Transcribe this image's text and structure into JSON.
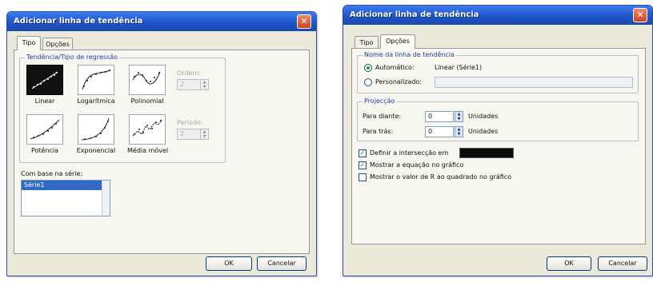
{
  "dialog_type": {
    "title": "Adicionar linha de tendência",
    "close_glyph": "✕",
    "tabs": [
      {
        "label": "Tipo",
        "active": true
      },
      {
        "label": "Opções",
        "active": false
      }
    ],
    "group_label": "Tendência/Tipo de regressão",
    "types": [
      {
        "label": "Linear",
        "icon": "linear-chart-icon",
        "selected": true
      },
      {
        "label": "Logarítmica",
        "icon": "log-chart-icon",
        "selected": false
      },
      {
        "label": "Polinomial",
        "icon": "polynomial-chart-icon",
        "selected": false
      },
      {
        "label": "Potência",
        "icon": "power-chart-icon",
        "selected": false
      },
      {
        "label": "Exponencial",
        "icon": "exponential-chart-icon",
        "selected": false
      },
      {
        "label": "Média móvel",
        "icon": "moving-average-chart-icon",
        "selected": false
      }
    ],
    "order_label": "Ordem:",
    "order_value": "2",
    "period_label": "Período:",
    "period_value": "2",
    "series_label": "Com base na série:",
    "series_items": [
      "Série1"
    ],
    "ok_label": "OK",
    "cancel_label": "Cancelar"
  },
  "dialog_options": {
    "title": "Adicionar linha de tendência",
    "close_glyph": "✕",
    "tabs": [
      {
        "label": "Tipo",
        "active": false
      },
      {
        "label": "Opções",
        "active": true
      }
    ],
    "name_group_label": "Nome da linha de tendência",
    "automatic_label": "Automático:",
    "automatic_value": "Linear (Série1)",
    "custom_label": "Personalizado:",
    "custom_value": "",
    "projection_group_label": "Projecção",
    "forward_label": "Para diante:",
    "forward_value": "0",
    "backward_label": "Para trás:",
    "backward_value": "0",
    "units_label": "Unidades",
    "intercept_label": "Definir a intersecção em",
    "intercept_checked": true,
    "show_equation_label": "Mostrar a equação no gráfico",
    "show_equation_checked": true,
    "show_r2_label": "Mostrar o valor de R ao quadrado no gráfico",
    "show_r2_checked": false,
    "ok_label": "OK",
    "cancel_label": "Cancelar"
  },
  "colors": {
    "titlebar": "#1f55c8",
    "dialog_bg": "#ece9d8",
    "group_label": "#1f3fa8",
    "selection": "#316ac5",
    "check_mark": "#21a121"
  }
}
